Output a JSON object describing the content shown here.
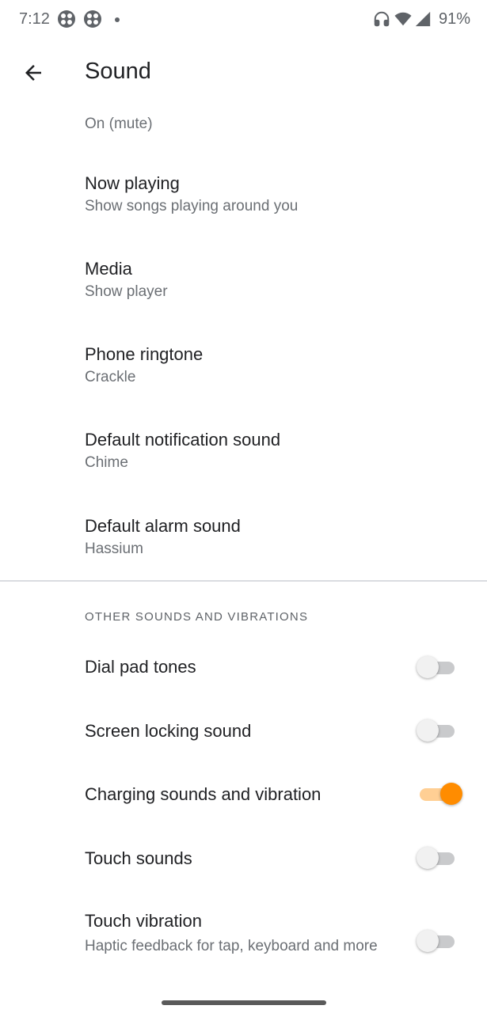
{
  "status_bar": {
    "time": "7:12",
    "battery": "91%",
    "icons": [
      "app-grid-icon",
      "app-grid-icon",
      "notification-dot",
      "headphones-icon",
      "wifi-icon",
      "signal-icon"
    ]
  },
  "app_bar": {
    "title": "Sound"
  },
  "list": {
    "cut_item": {
      "summary": "On (mute)"
    },
    "items": [
      {
        "title": "Now playing",
        "summary": "Show songs playing around you"
      },
      {
        "title": "Media",
        "summary": "Show player"
      },
      {
        "title": "Phone ringtone",
        "summary": "Crackle"
      },
      {
        "title": "Default notification sound",
        "summary": "Chime"
      },
      {
        "title": "Default alarm sound",
        "summary": "Hassium"
      }
    ]
  },
  "other_section": {
    "header": "OTHER SOUNDS AND VIBRATIONS",
    "toggles": [
      {
        "title": "Dial pad tones",
        "on": false
      },
      {
        "title": "Screen locking sound",
        "on": false
      },
      {
        "title": "Charging sounds and vibration",
        "on": true
      },
      {
        "title": "Touch sounds",
        "on": false
      },
      {
        "title": "Touch vibration",
        "summary": "Haptic feedback for tap, keyboard and more",
        "on": false
      }
    ]
  },
  "colors": {
    "accent": "#ff8c00",
    "accent_track": "#ffcf94",
    "off_track": "#c9cacc"
  }
}
